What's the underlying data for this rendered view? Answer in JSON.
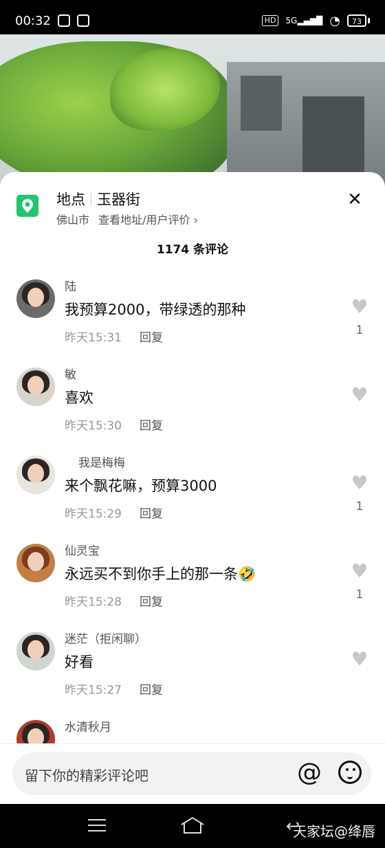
{
  "status": {
    "time": "00:32",
    "network": "5G",
    "battery": "73",
    "hd": "HD"
  },
  "location": {
    "label": "地点",
    "place": "玉器街",
    "city": "佛山市",
    "link": "查看地址/用户评价 ›"
  },
  "comment_count": "1174 条评论",
  "comments": [
    {
      "user": "陆",
      "text": "我预算2000，带绿透的那种",
      "time": "昨天15:31",
      "reply": "回复",
      "likes": "1"
    },
    {
      "user": "敏",
      "text": "喜欢",
      "time": "昨天15:30",
      "reply": "回复",
      "likes": ""
    },
    {
      "user": "我是梅梅",
      "text": "来个飘花嘛，预算3000",
      "time": "昨天15:29",
      "reply": "回复",
      "likes": "1"
    },
    {
      "user": "仙灵宝",
      "text": "永远买不到你手上的那一条🤣",
      "time": "昨天15:28",
      "reply": "回复",
      "likes": "1"
    },
    {
      "user": "迷茫（拒闲聊）",
      "text": "好看",
      "time": "昨天15:27",
      "reply": "回复",
      "likes": ""
    },
    {
      "user": "水清秋月",
      "text": "",
      "time": "",
      "reply": "",
      "likes": ""
    }
  ],
  "input": {
    "placeholder": "留下你的精彩评论吧",
    "at": "@"
  },
  "watermark": "天家坛@绛唇",
  "colors": {
    "accent": "#1ec86e"
  }
}
